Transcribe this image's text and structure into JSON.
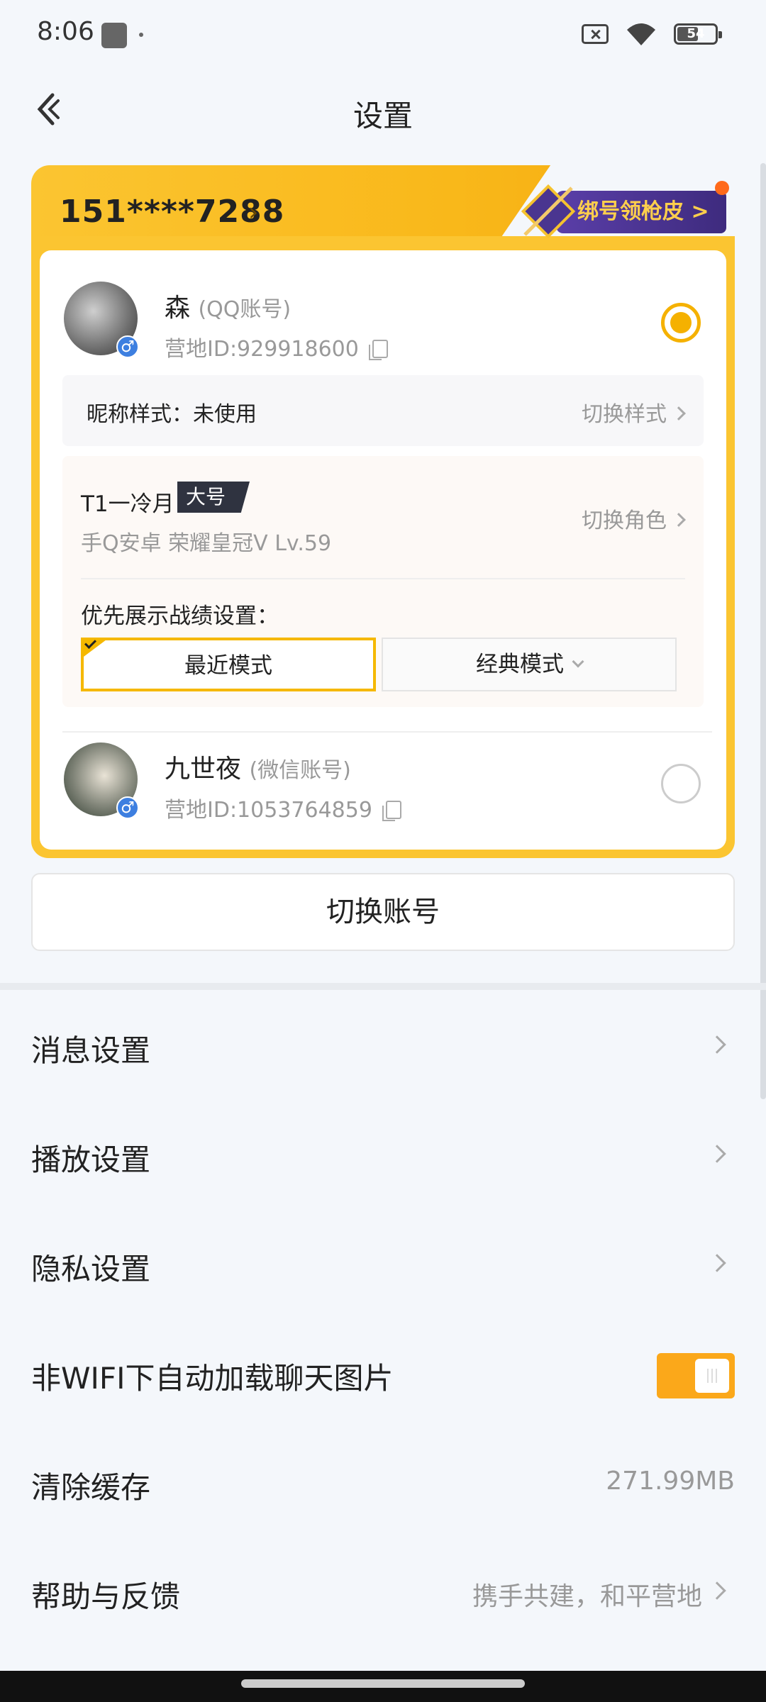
{
  "status_bar": {
    "time": "8:06",
    "battery": "54"
  },
  "header": {
    "title": "设置"
  },
  "account_card": {
    "phone": "151****7288",
    "promo_label": "绑号领枪皮 >",
    "accounts": [
      {
        "name": "森",
        "type": "(QQ账号)",
        "id": "营地ID:929918600",
        "selected": true,
        "gender": "♂"
      },
      {
        "name": "九世夜",
        "type": "(微信账号)",
        "id": "营地ID:1053764859",
        "selected": false,
        "gender": "♂"
      }
    ],
    "nickname_style": {
      "label": "昵称样式：未使用",
      "action": "切换样式"
    },
    "role": {
      "name": "T1一冷月",
      "tag": "大号",
      "detail": "手Q安卓  荣耀皇冠V  Lv.59",
      "action": "切换角色"
    },
    "preference": {
      "label": "优先展示战绩设置：",
      "modes": [
        "最近模式",
        "经典模式"
      ],
      "selected": "最近模式"
    },
    "switch_account": "切换账号"
  },
  "menu": {
    "items": [
      {
        "label": "消息设置"
      },
      {
        "label": "播放设置"
      },
      {
        "label": "隐私设置"
      },
      {
        "label": "非WIFI下自动加载聊天图片",
        "toggle": true
      },
      {
        "label": "清除缓存",
        "value": "271.99MB"
      },
      {
        "label": "帮助与反馈",
        "value": "携手共建，和平营地"
      }
    ]
  },
  "colors": {
    "accent": "#f5b100",
    "background": "#f4f7fb",
    "toggle_on": "#fba81a"
  }
}
